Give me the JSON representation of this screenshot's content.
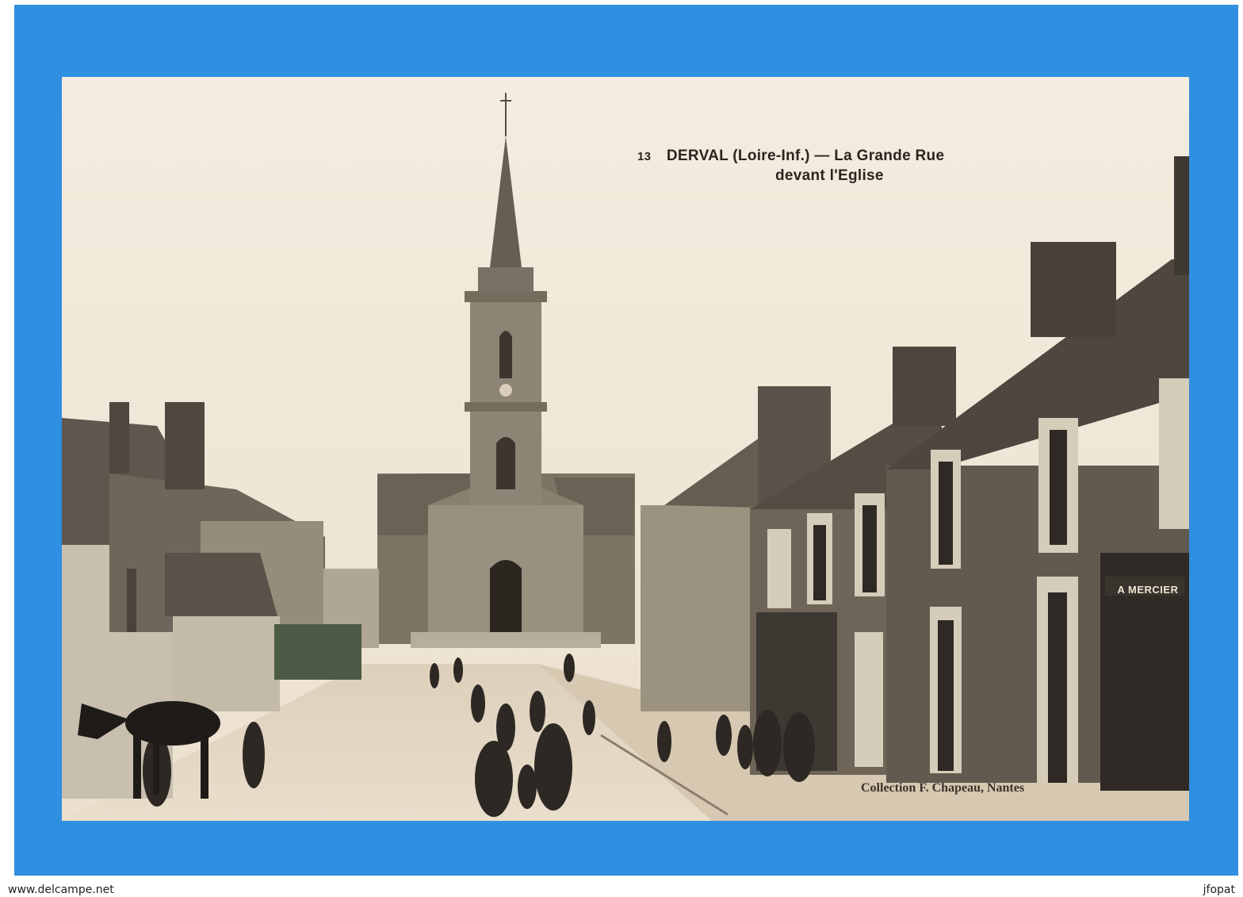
{
  "postcard": {
    "number": "13",
    "title_line1": "DERVAL (Loire-Inf.) — La Grande Rue",
    "title_line2": "devant l'Eglise",
    "collection": "Collection F. Chapeau, Nantes",
    "shop_sign": "A MERCIER"
  },
  "footer": {
    "left": "www.delcampe.net",
    "right": "jfopat"
  },
  "colors": {
    "frame": "#2f8fe0",
    "card": "#f2e9da",
    "ink": "#2b2520"
  }
}
